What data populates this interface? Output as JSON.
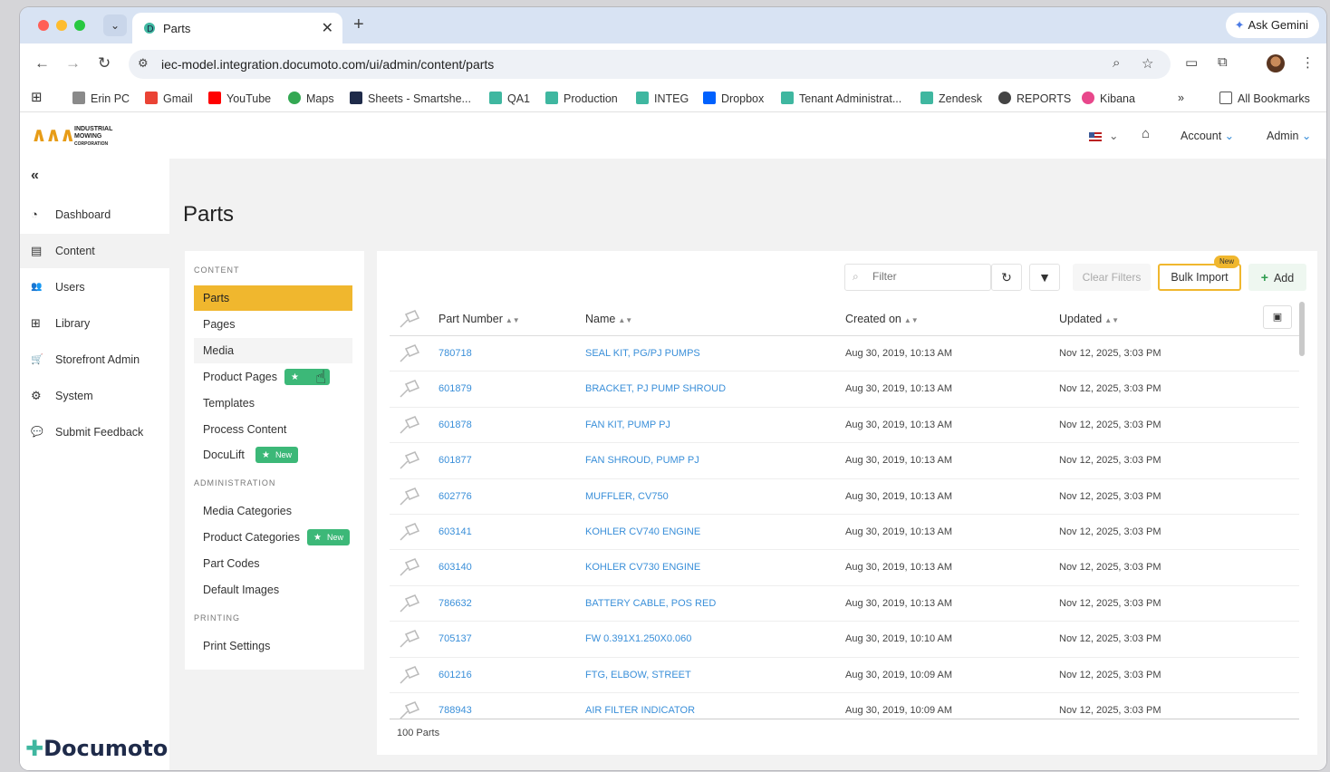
{
  "browser": {
    "tab_title": "Parts",
    "new_tab": "+",
    "tab_close": "✕",
    "gemini_label": "Ask Gemini",
    "url": "iec-model.integration.documoto.com/ui/admin/content/parts",
    "bookmarks": [
      "Erin PC",
      "Gmail",
      "YouTube",
      "Maps",
      "Sheets - Smartshe...",
      "QA1",
      "Production",
      "INTEG",
      "Dropbox",
      "Tenant Administrat...",
      "Zendesk",
      "REPORTS",
      "Kibana"
    ],
    "more": "»",
    "all_bookmarks": "All Bookmarks"
  },
  "header": {
    "logo_mark": "∧∧∧",
    "logo_text": [
      "INDUSTRIAL",
      "MOWING",
      "CORPORATION"
    ],
    "account": "Account",
    "admin": "Admin"
  },
  "sidebar": {
    "collapse": "«",
    "items": [
      {
        "label": "Dashboard",
        "icon": "dashboard-icon",
        "glyph": "◔"
      },
      {
        "label": "Content",
        "icon": "content-icon",
        "glyph": "▤"
      },
      {
        "label": "Users",
        "icon": "users-icon",
        "glyph": "👥"
      },
      {
        "label": "Library",
        "icon": "library-icon",
        "glyph": "⊞"
      },
      {
        "label": "Storefront Admin",
        "icon": "cart-icon",
        "glyph": "🛒"
      },
      {
        "label": "System",
        "icon": "gear-icon",
        "glyph": "⚙"
      },
      {
        "label": "Submit Feedback",
        "icon": "feedback-icon",
        "glyph": "💬"
      }
    ],
    "brand": "Documoto"
  },
  "page": {
    "title": "Parts"
  },
  "content_nav": {
    "sections": [
      {
        "heading": "CONTENT"
      },
      {
        "heading": "ADMINISTRATION"
      },
      {
        "heading": "PRINTING"
      }
    ],
    "items": [
      "Parts",
      "Pages",
      "Media",
      "Product Pages",
      "Templates",
      "Process Content",
      "DocuLift",
      "Media Categories",
      "Product Categories",
      "Part Codes",
      "Default Images",
      "Print Settings"
    ],
    "new_badge": "New"
  },
  "toolbar": {
    "filter_placeholder": "Filter",
    "clear_filters": "Clear Filters",
    "bulk_import": "Bulk Import",
    "bulk_new": "New",
    "add": "Add"
  },
  "table": {
    "columns": [
      "Part Number",
      "Name",
      "Created on",
      "Updated"
    ],
    "rows": [
      {
        "part": "780718",
        "name": "SEAL KIT, PG/PJ PUMPS",
        "created": "Aug 30, 2019, 10:13 AM",
        "updated": "Nov 12, 2025, 3:03 PM"
      },
      {
        "part": "601879",
        "name": "BRACKET, PJ PUMP SHROUD",
        "created": "Aug 30, 2019, 10:13 AM",
        "updated": "Nov 12, 2025, 3:03 PM"
      },
      {
        "part": "601878",
        "name": "FAN KIT, PUMP PJ",
        "created": "Aug 30, 2019, 10:13 AM",
        "updated": "Nov 12, 2025, 3:03 PM"
      },
      {
        "part": "601877",
        "name": "FAN SHROUD, PUMP PJ",
        "created": "Aug 30, 2019, 10:13 AM",
        "updated": "Nov 12, 2025, 3:03 PM"
      },
      {
        "part": "602776",
        "name": "MUFFLER, CV750",
        "created": "Aug 30, 2019, 10:13 AM",
        "updated": "Nov 12, 2025, 3:03 PM"
      },
      {
        "part": "603141",
        "name": "KOHLER CV740 ENGINE",
        "created": "Aug 30, 2019, 10:13 AM",
        "updated": "Nov 12, 2025, 3:03 PM"
      },
      {
        "part": "603140",
        "name": "KOHLER CV730 ENGINE",
        "created": "Aug 30, 2019, 10:13 AM",
        "updated": "Nov 12, 2025, 3:03 PM"
      },
      {
        "part": "786632",
        "name": "BATTERY CABLE, POS RED",
        "created": "Aug 30, 2019, 10:13 AM",
        "updated": "Nov 12, 2025, 3:03 PM"
      },
      {
        "part": "705137",
        "name": "FW 0.391X1.250X0.060",
        "created": "Aug 30, 2019, 10:10 AM",
        "updated": "Nov 12, 2025, 3:03 PM"
      },
      {
        "part": "601216",
        "name": "FTG, ELBOW, STREET",
        "created": "Aug 30, 2019, 10:09 AM",
        "updated": "Nov 12, 2025, 3:03 PM"
      },
      {
        "part": "788943",
        "name": "AIR FILTER INDICATOR",
        "created": "Aug 30, 2019, 10:09 AM",
        "updated": "Nov 12, 2025, 3:03 PM"
      }
    ],
    "count": "100 Parts"
  },
  "colors": {
    "accent": "#f0b72e",
    "link": "#3a8fd9",
    "new_badge": "#3cb878"
  }
}
